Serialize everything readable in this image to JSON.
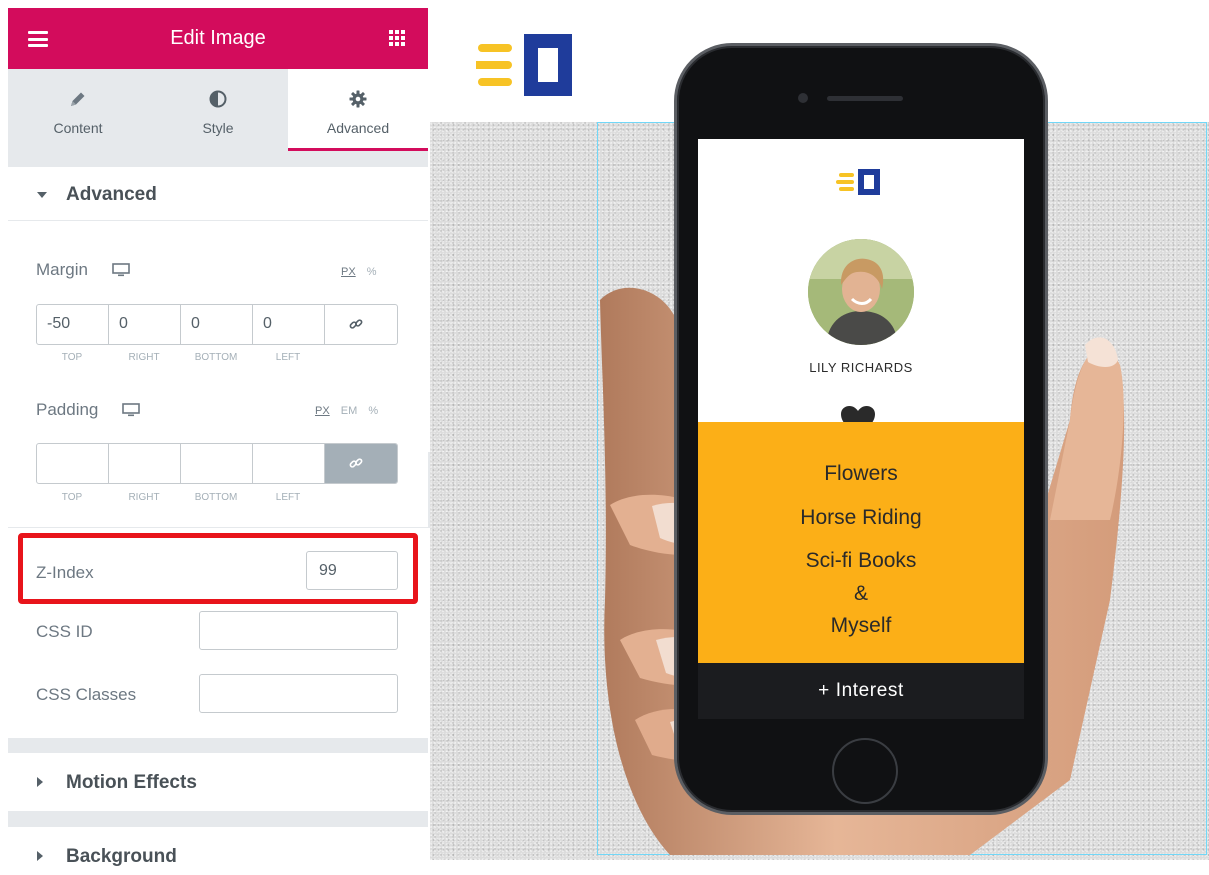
{
  "panel": {
    "title": "Edit Image",
    "tabs": [
      {
        "label": "Content",
        "icon": "pencil-icon",
        "active": false
      },
      {
        "label": "Style",
        "icon": "half-circle-icon",
        "active": false
      },
      {
        "label": "Advanced",
        "icon": "gear-icon",
        "active": true
      }
    ],
    "section_advanced": "Advanced",
    "margin": {
      "label": "Margin",
      "units": [
        "PX",
        "%"
      ],
      "selected_unit": "PX",
      "values": [
        "-50",
        "0",
        "0",
        "0"
      ],
      "sides": [
        "TOP",
        "RIGHT",
        "BOTTOM",
        "LEFT"
      ],
      "linked": false
    },
    "padding": {
      "label": "Padding",
      "units": [
        "PX",
        "EM",
        "%"
      ],
      "selected_unit": "PX",
      "values": [
        "",
        "",
        "",
        ""
      ],
      "sides": [
        "TOP",
        "RIGHT",
        "BOTTOM",
        "LEFT"
      ],
      "linked": true
    },
    "z_index": {
      "label": "Z-Index",
      "value": "99"
    },
    "css_id": {
      "label": "CSS ID",
      "value": ""
    },
    "css_classes": {
      "label": "CSS Classes",
      "value": ""
    },
    "section_motion": "Motion Effects",
    "section_background": "Background",
    "collapse_glyph": "‹"
  },
  "preview": {
    "person_name": "LILY RICHARDS",
    "interests": [
      "Flowers",
      "Horse Riding",
      "Sci-fi Books",
      "&",
      "Myself"
    ],
    "button_label": "+ Interest"
  },
  "colors": {
    "brand": "#d30c5c",
    "highlight": "#e8141b",
    "logo_yellow": "#f7c325",
    "logo_blue": "#1f3c9b",
    "interest_bg": "#fcaf17"
  }
}
